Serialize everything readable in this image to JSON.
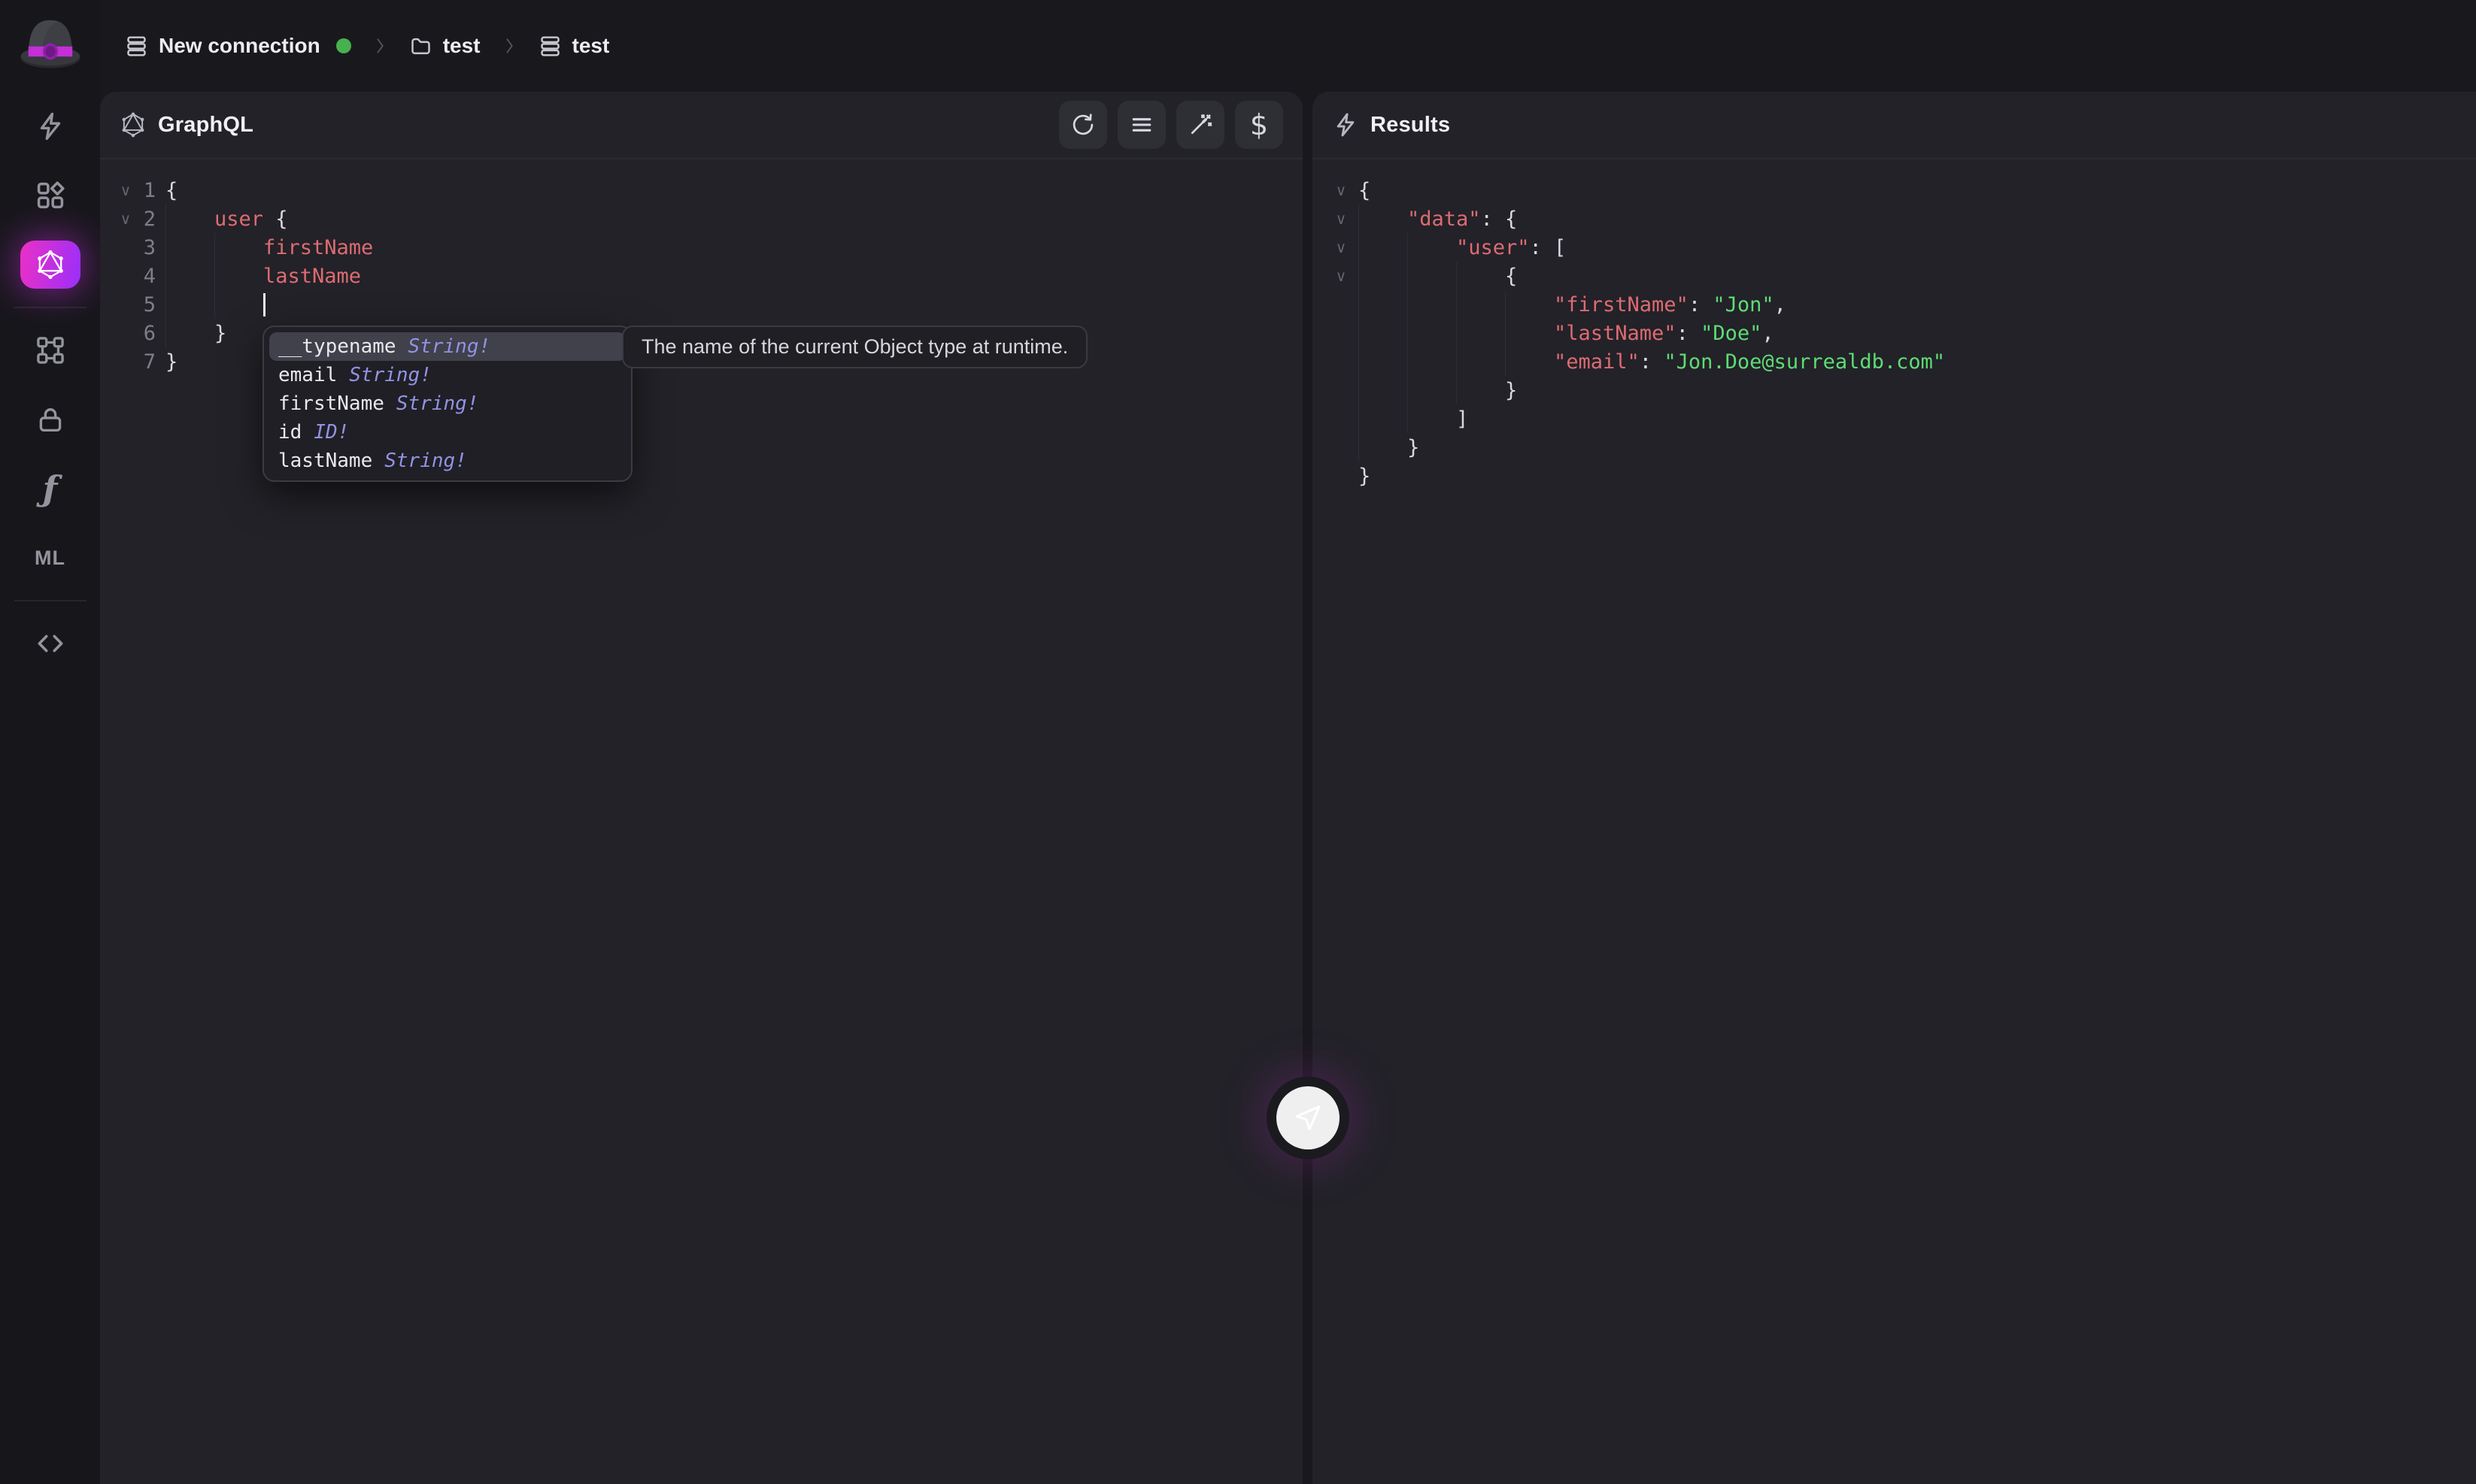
{
  "topbar": {
    "connection": {
      "label": "New connection",
      "icon": "table-stack-icon",
      "status_dot_color": "#47b14e"
    },
    "breadcrumbs": [
      {
        "name": "database",
        "label": "test",
        "icon": "folder-icon"
      },
      {
        "name": "table",
        "label": "test",
        "icon": "table-stack-icon"
      }
    ]
  },
  "sidebar": {
    "active_gradient": [
      "#ec30c5",
      "#9a2ffa"
    ],
    "items": [
      {
        "name": "query",
        "icon": "lightning-icon"
      },
      {
        "name": "explorer",
        "icon": "dashboard-icon"
      },
      {
        "name": "graphql",
        "icon": "graphql-icon",
        "active": true
      },
      {
        "type": "divider"
      },
      {
        "name": "designer",
        "icon": "scheme-icon"
      },
      {
        "name": "authentication",
        "icon": "lock-icon"
      },
      {
        "name": "functions",
        "icon": "function-icon"
      },
      {
        "name": "models",
        "icon": "ml-icon"
      },
      {
        "type": "divider"
      },
      {
        "name": "api-docs",
        "icon": "code-icon"
      }
    ]
  },
  "graphql_panel": {
    "title": "GraphQL",
    "icon": "graphql-icon",
    "toolbar": [
      {
        "name": "refresh",
        "icon": "refresh-icon"
      },
      {
        "name": "format",
        "icon": "align-lines-icon"
      },
      {
        "name": "prettify",
        "icon": "wand-icon"
      },
      {
        "name": "variables",
        "icon": "dollar-icon"
      }
    ],
    "editor": {
      "lines": [
        {
          "num": 1,
          "fold": true,
          "indent": 0,
          "segments": [
            {
              "text": "{",
              "style": "brace"
            }
          ]
        },
        {
          "num": 2,
          "fold": true,
          "indent": 1,
          "segments": [
            {
              "text": "user",
              "style": "field"
            },
            {
              "text": " {",
              "style": "brace"
            }
          ]
        },
        {
          "num": 3,
          "indent": 2,
          "segments": [
            {
              "text": "firstName",
              "style": "field"
            }
          ]
        },
        {
          "num": 4,
          "indent": 2,
          "segments": [
            {
              "text": "lastName",
              "style": "field"
            }
          ]
        },
        {
          "num": 5,
          "indent": 2,
          "segments": [
            {
              "text": "",
              "style": "cursor"
            }
          ]
        },
        {
          "num": 6,
          "indent": 1,
          "segments": [
            {
              "text": "}",
              "style": "brace"
            }
          ]
        },
        {
          "num": 7,
          "indent": 0,
          "segments": [
            {
              "text": "}",
              "style": "brace"
            }
          ]
        }
      ]
    },
    "autocomplete": {
      "items": [
        {
          "label": "__typename",
          "type": "String!",
          "selected": true
        },
        {
          "label": "email",
          "type": "String!"
        },
        {
          "label": "firstName",
          "type": "String!"
        },
        {
          "label": "id",
          "type": "ID!"
        },
        {
          "label": "lastName",
          "type": "String!"
        }
      ],
      "tooltip": "The name of the current Object type at runtime."
    }
  },
  "results_panel": {
    "title": "Results",
    "icon": "lightning-icon",
    "lines": [
      {
        "fold": true,
        "indent": 0,
        "segments": [
          {
            "text": "{",
            "style": "brace"
          }
        ]
      },
      {
        "fold": true,
        "indent": 1,
        "segments": [
          {
            "text": "\"data\"",
            "style": "key"
          },
          {
            "text": ": {",
            "style": "brace"
          }
        ]
      },
      {
        "fold": true,
        "indent": 2,
        "segments": [
          {
            "text": "\"user\"",
            "style": "key"
          },
          {
            "text": ": [",
            "style": "brace"
          }
        ]
      },
      {
        "fold": true,
        "indent": 3,
        "segments": [
          {
            "text": "{",
            "style": "brace"
          }
        ]
      },
      {
        "indent": 4,
        "segments": [
          {
            "text": "\"firstName\"",
            "style": "key"
          },
          {
            "text": ": ",
            "style": "brace"
          },
          {
            "text": "\"Jon\"",
            "style": "string"
          },
          {
            "text": ",",
            "style": "brace"
          }
        ]
      },
      {
        "indent": 4,
        "segments": [
          {
            "text": "\"lastName\"",
            "style": "key"
          },
          {
            "text": ": ",
            "style": "brace"
          },
          {
            "text": "\"Doe\"",
            "style": "string"
          },
          {
            "text": ",",
            "style": "brace"
          }
        ]
      },
      {
        "indent": 4,
        "segments": [
          {
            "text": "\"email\"",
            "style": "key"
          },
          {
            "text": ": ",
            "style": "brace"
          },
          {
            "text": "\"Jon.Doe@surrealdb.com\"",
            "style": "string"
          }
        ]
      },
      {
        "indent": 3,
        "segments": [
          {
            "text": "}",
            "style": "brace"
          }
        ]
      },
      {
        "indent": 2,
        "segments": [
          {
            "text": "]",
            "style": "brace"
          }
        ]
      },
      {
        "indent": 1,
        "segments": [
          {
            "text": "}",
            "style": "brace"
          }
        ]
      },
      {
        "indent": 0,
        "segments": [
          {
            "text": "}",
            "style": "brace"
          }
        ]
      }
    ]
  },
  "run_button": {
    "icon": "send-icon"
  }
}
